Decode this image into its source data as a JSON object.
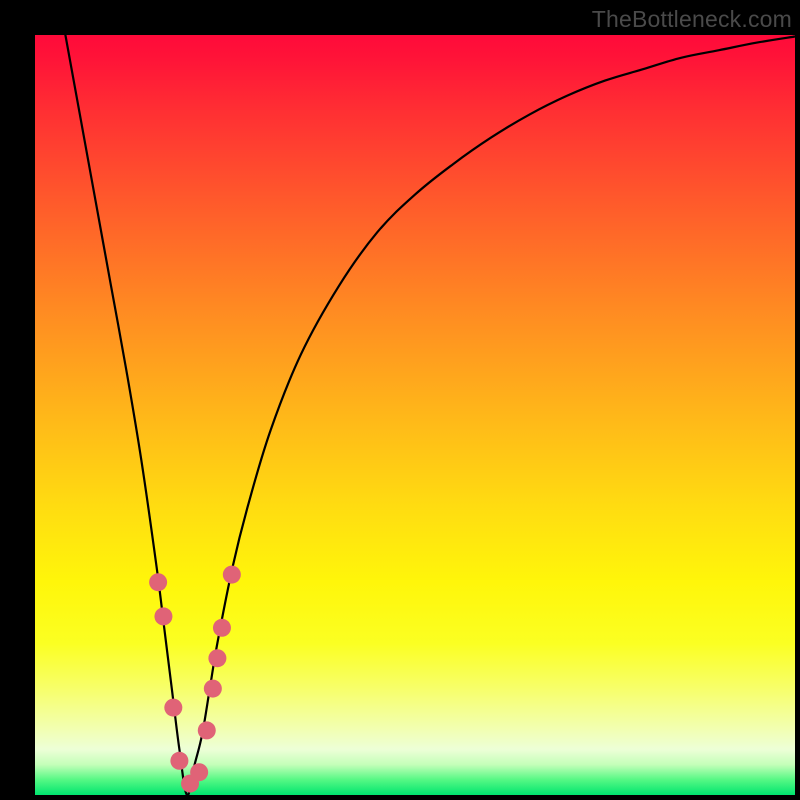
{
  "watermark": {
    "text": "TheBottleneck.com"
  },
  "chart_data": {
    "type": "line",
    "title": "",
    "xlabel": "",
    "ylabel": "",
    "xlim": [
      0,
      100
    ],
    "ylim": [
      0,
      100
    ],
    "optimum_x": 20,
    "series": [
      {
        "name": "bottleneck-curve",
        "x": [
          4,
          6,
          8,
          10,
          12,
          14,
          16,
          17,
          18,
          19,
          20,
          21,
          22,
          23,
          24,
          26,
          28,
          31,
          35,
          40,
          45,
          50,
          55,
          60,
          65,
          70,
          75,
          80,
          85,
          90,
          95,
          100
        ],
        "y": [
          100,
          89,
          78,
          67,
          56,
          44,
          30,
          22,
          14,
          6,
          0,
          4,
          8,
          14,
          20,
          30,
          38,
          48,
          58,
          67,
          74,
          79,
          83,
          86.5,
          89.5,
          92,
          94,
          95.5,
          97,
          98,
          99,
          99.8
        ]
      }
    ],
    "markers": {
      "name": "highlight-points",
      "x": [
        16.2,
        16.9,
        18.2,
        19.0,
        20.4,
        21.6,
        22.6,
        23.4,
        24.0,
        24.6,
        25.9
      ],
      "y": [
        28,
        23.5,
        11.5,
        4.5,
        1.5,
        3.0,
        8.5,
        14,
        18,
        22,
        29
      ],
      "color": "#e06377",
      "radius": 9
    },
    "background_gradient": {
      "stops": [
        {
          "pos": 0,
          "color": "#ff0a3a"
        },
        {
          "pos": 50,
          "color": "#ffb719"
        },
        {
          "pos": 80,
          "color": "#f7ff6a"
        },
        {
          "pos": 100,
          "color": "#00e56f"
        }
      ]
    }
  }
}
